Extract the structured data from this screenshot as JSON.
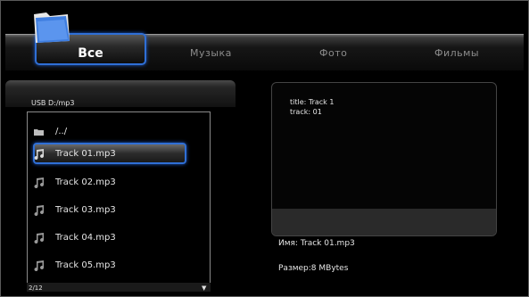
{
  "tabs": {
    "all": "Все",
    "music": "Музыка",
    "photo": "Фото",
    "films": "Фильмы"
  },
  "browser": {
    "path": "USB D:/mp3",
    "parent": "/../",
    "files": [
      "Track 01.mp3",
      "Track 02.mp3",
      "Track 03.mp3",
      "Track 04.mp3",
      "Track 05.mp3"
    ],
    "page": "2/12",
    "scroll_indicator": "▼"
  },
  "details": {
    "title_line": "title: Track 1",
    "track_line": "track: 01",
    "name_line": "Имя: Track 01.mp3",
    "size_line": "Размер:8 MBytes"
  },
  "colors": {
    "focus": "#2f6fd6",
    "folder": "#3f7ee0"
  },
  "icons": {
    "media_folder": "folder-icon",
    "parent": "folder-small-icon",
    "file": "music-note-icon"
  }
}
